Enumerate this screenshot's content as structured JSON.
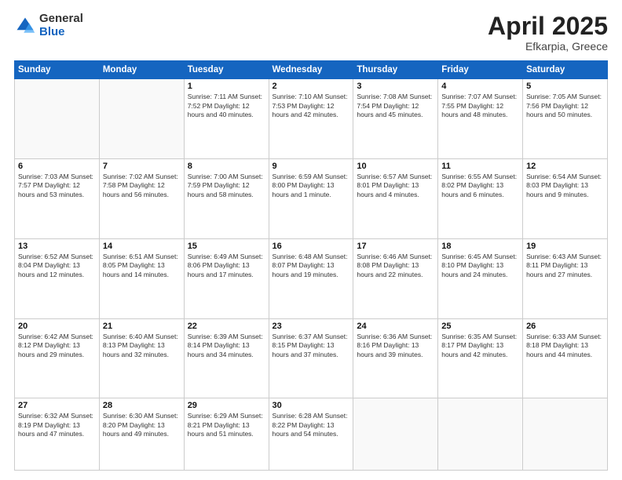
{
  "logo": {
    "general": "General",
    "blue": "Blue"
  },
  "title": {
    "month": "April 2025",
    "location": "Efkarpia, Greece"
  },
  "weekdays": [
    "Sunday",
    "Monday",
    "Tuesday",
    "Wednesday",
    "Thursday",
    "Friday",
    "Saturday"
  ],
  "weeks": [
    [
      {
        "day": "",
        "info": ""
      },
      {
        "day": "",
        "info": ""
      },
      {
        "day": "1",
        "info": "Sunrise: 7:11 AM\nSunset: 7:52 PM\nDaylight: 12 hours and 40 minutes."
      },
      {
        "day": "2",
        "info": "Sunrise: 7:10 AM\nSunset: 7:53 PM\nDaylight: 12 hours and 42 minutes."
      },
      {
        "day": "3",
        "info": "Sunrise: 7:08 AM\nSunset: 7:54 PM\nDaylight: 12 hours and 45 minutes."
      },
      {
        "day": "4",
        "info": "Sunrise: 7:07 AM\nSunset: 7:55 PM\nDaylight: 12 hours and 48 minutes."
      },
      {
        "day": "5",
        "info": "Sunrise: 7:05 AM\nSunset: 7:56 PM\nDaylight: 12 hours and 50 minutes."
      }
    ],
    [
      {
        "day": "6",
        "info": "Sunrise: 7:03 AM\nSunset: 7:57 PM\nDaylight: 12 hours and 53 minutes."
      },
      {
        "day": "7",
        "info": "Sunrise: 7:02 AM\nSunset: 7:58 PM\nDaylight: 12 hours and 56 minutes."
      },
      {
        "day": "8",
        "info": "Sunrise: 7:00 AM\nSunset: 7:59 PM\nDaylight: 12 hours and 58 minutes."
      },
      {
        "day": "9",
        "info": "Sunrise: 6:59 AM\nSunset: 8:00 PM\nDaylight: 13 hours and 1 minute."
      },
      {
        "day": "10",
        "info": "Sunrise: 6:57 AM\nSunset: 8:01 PM\nDaylight: 13 hours and 4 minutes."
      },
      {
        "day": "11",
        "info": "Sunrise: 6:55 AM\nSunset: 8:02 PM\nDaylight: 13 hours and 6 minutes."
      },
      {
        "day": "12",
        "info": "Sunrise: 6:54 AM\nSunset: 8:03 PM\nDaylight: 13 hours and 9 minutes."
      }
    ],
    [
      {
        "day": "13",
        "info": "Sunrise: 6:52 AM\nSunset: 8:04 PM\nDaylight: 13 hours and 12 minutes."
      },
      {
        "day": "14",
        "info": "Sunrise: 6:51 AM\nSunset: 8:05 PM\nDaylight: 13 hours and 14 minutes."
      },
      {
        "day": "15",
        "info": "Sunrise: 6:49 AM\nSunset: 8:06 PM\nDaylight: 13 hours and 17 minutes."
      },
      {
        "day": "16",
        "info": "Sunrise: 6:48 AM\nSunset: 8:07 PM\nDaylight: 13 hours and 19 minutes."
      },
      {
        "day": "17",
        "info": "Sunrise: 6:46 AM\nSunset: 8:08 PM\nDaylight: 13 hours and 22 minutes."
      },
      {
        "day": "18",
        "info": "Sunrise: 6:45 AM\nSunset: 8:10 PM\nDaylight: 13 hours and 24 minutes."
      },
      {
        "day": "19",
        "info": "Sunrise: 6:43 AM\nSunset: 8:11 PM\nDaylight: 13 hours and 27 minutes."
      }
    ],
    [
      {
        "day": "20",
        "info": "Sunrise: 6:42 AM\nSunset: 8:12 PM\nDaylight: 13 hours and 29 minutes."
      },
      {
        "day": "21",
        "info": "Sunrise: 6:40 AM\nSunset: 8:13 PM\nDaylight: 13 hours and 32 minutes."
      },
      {
        "day": "22",
        "info": "Sunrise: 6:39 AM\nSunset: 8:14 PM\nDaylight: 13 hours and 34 minutes."
      },
      {
        "day": "23",
        "info": "Sunrise: 6:37 AM\nSunset: 8:15 PM\nDaylight: 13 hours and 37 minutes."
      },
      {
        "day": "24",
        "info": "Sunrise: 6:36 AM\nSunset: 8:16 PM\nDaylight: 13 hours and 39 minutes."
      },
      {
        "day": "25",
        "info": "Sunrise: 6:35 AM\nSunset: 8:17 PM\nDaylight: 13 hours and 42 minutes."
      },
      {
        "day": "26",
        "info": "Sunrise: 6:33 AM\nSunset: 8:18 PM\nDaylight: 13 hours and 44 minutes."
      }
    ],
    [
      {
        "day": "27",
        "info": "Sunrise: 6:32 AM\nSunset: 8:19 PM\nDaylight: 13 hours and 47 minutes."
      },
      {
        "day": "28",
        "info": "Sunrise: 6:30 AM\nSunset: 8:20 PM\nDaylight: 13 hours and 49 minutes."
      },
      {
        "day": "29",
        "info": "Sunrise: 6:29 AM\nSunset: 8:21 PM\nDaylight: 13 hours and 51 minutes."
      },
      {
        "day": "30",
        "info": "Sunrise: 6:28 AM\nSunset: 8:22 PM\nDaylight: 13 hours and 54 minutes."
      },
      {
        "day": "",
        "info": ""
      },
      {
        "day": "",
        "info": ""
      },
      {
        "day": "",
        "info": ""
      }
    ]
  ]
}
